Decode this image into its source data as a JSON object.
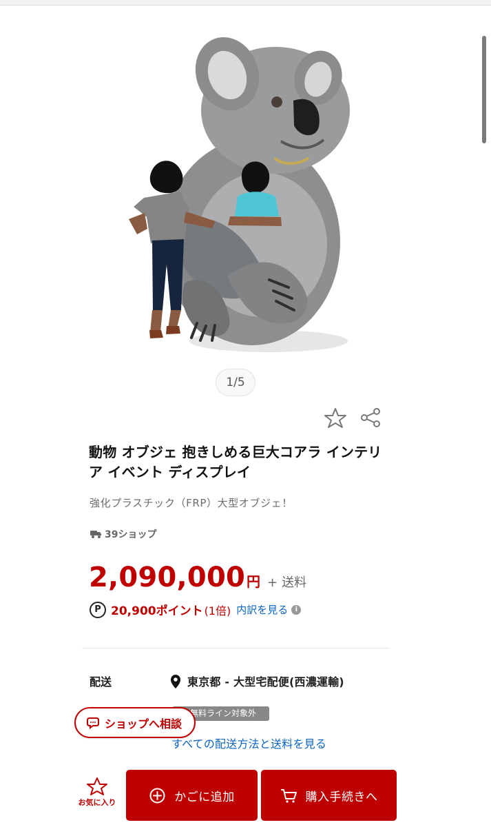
{
  "product": {
    "image_counter": "1/5",
    "title": "動物 オブジェ 抱きしめる巨大コアラ インテリア イベント ディスプレイ",
    "subtitle": "強化プラスチック（FRP）大型オブジェ！",
    "shop_badge": "39ショップ",
    "price": "2,090,000",
    "yen": "円",
    "plus": "+",
    "shipping": "送料",
    "points": "20,900ポイント",
    "points_multiplier": "(1倍)",
    "breakdown_link": "内訳を見る",
    "icons": [
      "star-outline-icon",
      "share-icon",
      "truck-icon",
      "point-icon",
      "info-icon",
      "location-pin-icon"
    ]
  },
  "delivery": {
    "label": "配送",
    "location": "東京都 - 大型宅配便(西濃運輸)",
    "tag": "無料ライン対象外",
    "all_link": "すべての配送方法と送料を見る"
  },
  "actions": {
    "consult": "ショップへ相談",
    "favorite": "お気に入り",
    "cart": "かごに追加",
    "checkout": "購入手続きへ"
  },
  "colors": {
    "accent": "#bf0000",
    "link": "#0b64c2",
    "muted": "#666666"
  }
}
